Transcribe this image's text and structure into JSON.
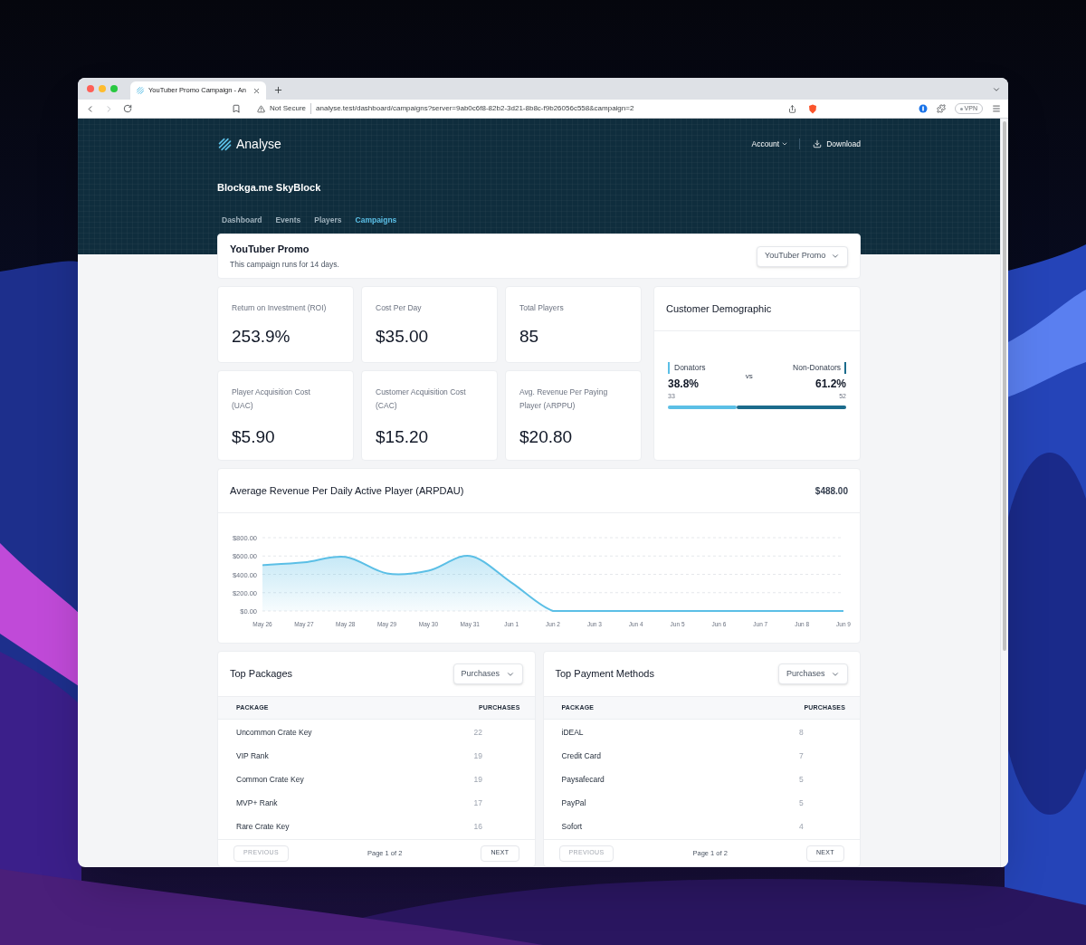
{
  "browser": {
    "tab_title": "YouTuber Promo Campaign - An",
    "security": "Not Secure",
    "url": "analyse.test/dashboard/campaigns?server=9ab0c6f8-82b2-3d21-8b8c-f9b26056c558&campaign=2",
    "vpn": "VPN"
  },
  "header": {
    "logo": "Analyse",
    "account": "Account",
    "download": "Download",
    "project": "Blockga.me SkyBlock",
    "nav": [
      {
        "label": "Dashboard",
        "selected": false
      },
      {
        "label": "Events",
        "selected": false
      },
      {
        "label": "Players",
        "selected": false
      },
      {
        "label": "Campaigns",
        "selected": true
      }
    ]
  },
  "campaign": {
    "title": "YouTuber Promo",
    "subtitle": "This campaign runs for 14 days.",
    "select": "YouTuber Promo"
  },
  "stats": [
    {
      "label": "Return on Investment (ROI)",
      "value": "253.9%"
    },
    {
      "label": "Cost Per Day",
      "value": "$35.00"
    },
    {
      "label": "Total Players",
      "value": "85"
    },
    {
      "label": "Player Acquisition Cost (UAC)",
      "value": "$5.90"
    },
    {
      "label": "Customer Acquisition Cost (CAC)",
      "value": "$15.20"
    },
    {
      "label": "Avg. Revenue Per Paying Player (ARPPU)",
      "value": "$20.80"
    }
  ],
  "demographic": {
    "title": "Customer Demographic",
    "vs": "vs",
    "groups": [
      {
        "label": "Donators",
        "percent": "38.8%",
        "count": "33",
        "level": 0.388,
        "color": "#5bbfe6"
      },
      {
        "label": "Non-Donators",
        "percent": "61.2%",
        "count": "52",
        "level": 0.612,
        "color": "#1b6b8c"
      }
    ]
  },
  "arpdau": {
    "title": "Average Revenue Per Daily Active Player (ARPDAU)",
    "total": "$488.00",
    "chart_data": {
      "type": "area",
      "categories": [
        "May 26",
        "May 27",
        "May 28",
        "May 29",
        "May 30",
        "May 31",
        "Jun 1",
        "Jun 2",
        "Jun 3",
        "Jun 4",
        "Jun 5",
        "Jun 6",
        "Jun 7",
        "Jun 8",
        "Jun 9"
      ],
      "grid": true,
      "series": [
        {
          "color": "#5bbfe6",
          "values": [
            500,
            530,
            590,
            410,
            440,
            600,
            310,
            0,
            0,
            0,
            0,
            0,
            0,
            0,
            0
          ]
        }
      ],
      "ylim": [
        0,
        800
      ],
      "yticks": [
        {
          "value": 0,
          "label": "$0.00"
        },
        {
          "value": 200,
          "label": "$200.00"
        },
        {
          "value": 400,
          "label": "$400.00"
        },
        {
          "value": 600,
          "label": "$600.00"
        },
        {
          "value": 800,
          "label": "$800.00"
        }
      ]
    }
  },
  "tables": [
    {
      "title": "Top Packages",
      "select": "Purchases",
      "columns": [
        "PACKAGE",
        "PURCHASES"
      ],
      "rows": [
        [
          "Uncommon Crate Key",
          "22"
        ],
        [
          "VIP Rank",
          "19"
        ],
        [
          "Common Crate Key",
          "19"
        ],
        [
          "MVP+ Rank",
          "17"
        ],
        [
          "Rare Crate Key",
          "16"
        ]
      ],
      "previous": {
        "label": "PREVIOUS",
        "disabled": true
      },
      "page": "Page 1 of 2",
      "next": {
        "label": "NEXT",
        "disabled": false
      }
    },
    {
      "title": "Top Payment Methods",
      "select": "Purchases",
      "columns": [
        "PACKAGE",
        "PURCHASES"
      ],
      "rows": [
        [
          "iDEAL",
          "8"
        ],
        [
          "Credit Card",
          "7"
        ],
        [
          "Paysafecard",
          "5"
        ],
        [
          "PayPal",
          "5"
        ],
        [
          "Sofort",
          "4"
        ]
      ],
      "previous": {
        "label": "PREVIOUS",
        "disabled": true
      },
      "page": "Page 1 of 2",
      "next": {
        "label": "NEXT",
        "disabled": false
      }
    }
  ]
}
